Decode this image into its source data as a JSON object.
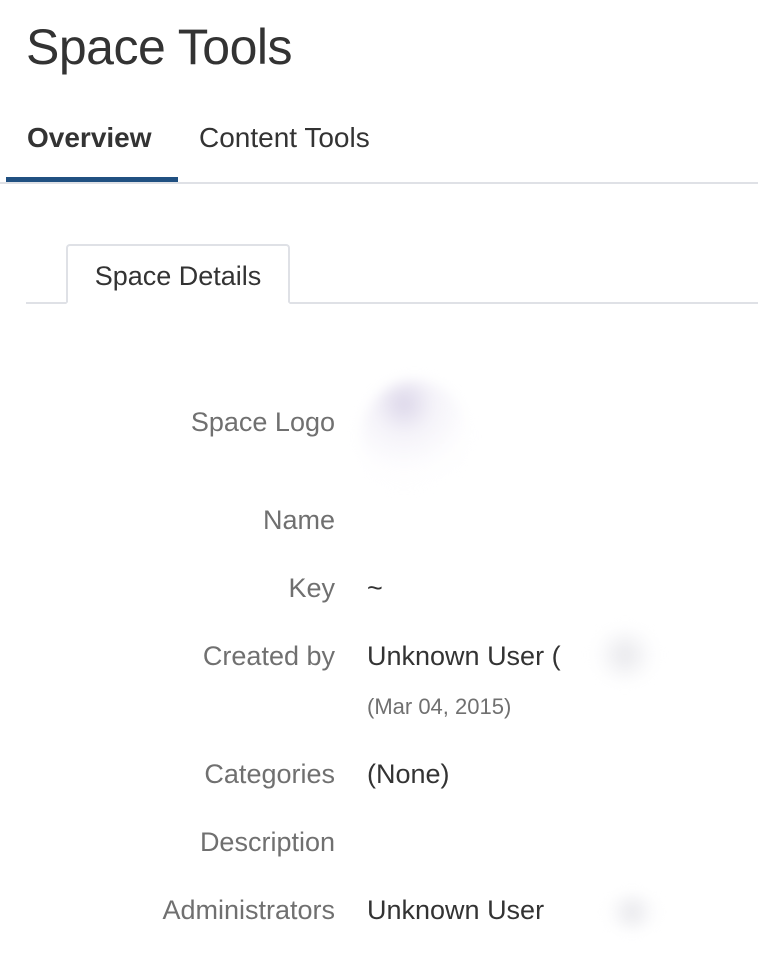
{
  "page": {
    "title": "Space Tools"
  },
  "main_tabs": [
    {
      "label": "Overview",
      "active": true
    },
    {
      "label": "Content Tools",
      "active": false
    }
  ],
  "sub_tabs": [
    {
      "label": "Space Details",
      "active": true
    }
  ],
  "details": {
    "logo_label": "Space Logo",
    "name_label": "Name",
    "name_value": "",
    "key_label": "Key",
    "key_value": "~",
    "created_by_label": "Created by",
    "created_by_value": "Unknown User (",
    "created_date": "(Mar 04, 2015)",
    "categories_label": "Categories",
    "categories_value": "(None)",
    "description_label": "Description",
    "description_value": "",
    "administrators_label": "Administrators",
    "administrators_value": "Unknown User"
  },
  "colors": {
    "active_tab_underline": "#205081",
    "label_text": "#707070",
    "value_text": "#333333",
    "divider": "#dfe1e6"
  }
}
